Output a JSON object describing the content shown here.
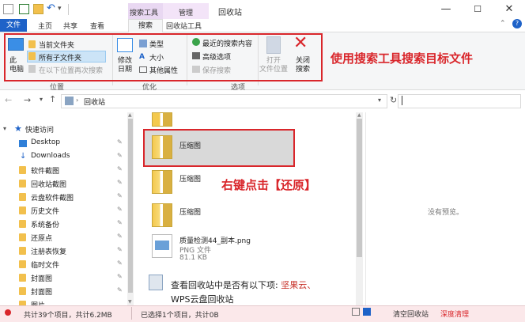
{
  "title_bar": {
    "context_tab_search_tools": "搜索工具",
    "context_tab_manage": "管理",
    "window_title": "回收站",
    "minimize": "—",
    "maximize": "☐",
    "close": "✕"
  },
  "ribbon_tabs": {
    "file": "文件",
    "home": "主页",
    "share": "共享",
    "view": "查看",
    "search": "搜索",
    "recycle_tools": "回收站工具"
  },
  "ribbon": {
    "this_pc": "此\n电脑",
    "current_folder": "当前文件夹",
    "all_subfolders": "所有子文件夹",
    "search_again_in": "在以下位置再次搜索",
    "modified_date": "修改\n日期",
    "type": "类型",
    "size": "大小",
    "other_properties": "其他属性",
    "recent_searches": "最近的搜索内容",
    "advanced_options": "高级选项",
    "save_search": "保存搜索",
    "open_file_location": "打开\n文件位置",
    "close_search": "关闭\n搜索",
    "group_location": "位置",
    "group_refine": "优化",
    "group_options": "选项"
  },
  "annotation_ribbon": "使用搜索工具搜索目标文件",
  "address": {
    "path": "回收站"
  },
  "nav": {
    "quick_access": "快速访问",
    "items": [
      {
        "label": "Desktop",
        "kind": "desktop"
      },
      {
        "label": "Downloads",
        "kind": "download"
      },
      {
        "label": "软件截图",
        "kind": "folder"
      },
      {
        "label": "回收站截图",
        "kind": "folder"
      },
      {
        "label": "云盘软件截图",
        "kind": "folder"
      },
      {
        "label": "历史文件",
        "kind": "folder"
      },
      {
        "label": "系统备份",
        "kind": "folder"
      },
      {
        "label": "还原点",
        "kind": "folder"
      },
      {
        "label": "注册表恢复",
        "kind": "folder"
      },
      {
        "label": "临时文件",
        "kind": "folder"
      },
      {
        "label": "封面图",
        "kind": "folder"
      },
      {
        "label": "封面图",
        "kind": "folder"
      },
      {
        "label": "图片",
        "kind": "folder"
      }
    ]
  },
  "files": [
    {
      "name": "压缩图",
      "selected": true
    },
    {
      "name": "压缩图",
      "selected": false
    },
    {
      "name": "压缩图",
      "selected": false
    }
  ],
  "png_file": {
    "name": "质量检测44_副本.png",
    "type": "PNG 文件",
    "size": "81.1 KB"
  },
  "annotation_file": "右键点击【还原】",
  "preview_text": "没有预览。",
  "tip": {
    "line1_prefix": "查看回收站中是否有以下项: ",
    "line1_keyword": "坚果云、",
    "line2_keyword": "WPS云盘回收站"
  },
  "status": {
    "count": "共计39个项目，共计6.2MB",
    "selected": "已选择1个项目，共计0B",
    "empty_bin": "清空回收站",
    "deep_clean": "深度清理"
  },
  "colors": {
    "accent_blue": "#1e62c8",
    "annotation_red": "#d9262b",
    "context_purple": "#e9d8f2"
  }
}
